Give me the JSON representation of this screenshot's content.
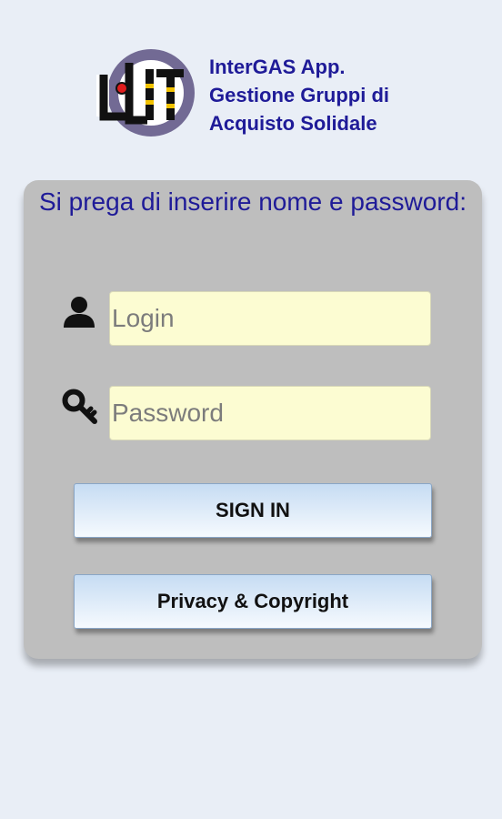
{
  "header": {
    "title_lines": [
      "InterGAS App.",
      "Gestione Gruppi di",
      "Acquisto Solidale"
    ]
  },
  "login_panel": {
    "prompt": "Si prega di inserire nome e password:",
    "login_placeholder": "Login",
    "password_placeholder": "Password",
    "sign_in_label": "SIGN IN",
    "privacy_label": "Privacy & Copyright"
  },
  "icons": {
    "logo": "intergas-logo",
    "login": "user-icon",
    "password": "key-icon"
  },
  "colors": {
    "background": "#e9eef6",
    "panel": "#bebebe",
    "accent_text": "#1f1b98",
    "input_background": "#fcfcd2",
    "button_gradient_top": "#c6dcf3",
    "button_gradient_bottom": "#f6fafe"
  }
}
